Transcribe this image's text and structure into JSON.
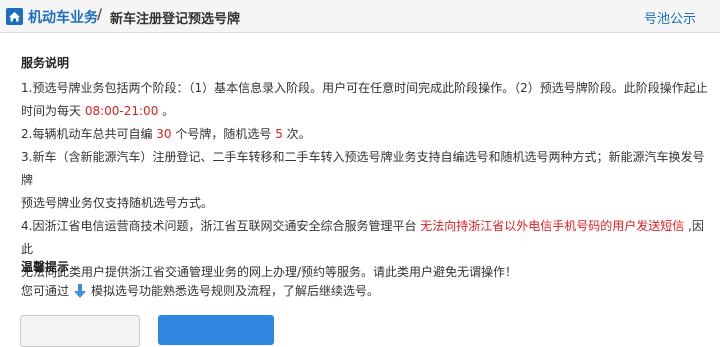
{
  "header": {
    "crumb_root": "机动车业务",
    "crumb_sep": "/",
    "crumb_current": "新车注册登记预选号牌",
    "pool_link": "号池公示"
  },
  "service": {
    "title": "服务说明",
    "p1_a": "1.预选号牌业务包括两个阶段：（1）基本信息录入阶段。用户可在任意时间完成此阶段操作。（2）预选号牌阶段。此阶段操作起止",
    "p1_b": "时间为每天 ",
    "p1_time": "08:00-21:00",
    "p1_c": " 。",
    "p2_a": "2.每辆机动车总共可自编 ",
    "p2_n1": "30",
    "p2_b": " 个号牌，随机选号 ",
    "p2_n2": "5",
    "p2_c": " 次。",
    "p3_a": "3.新车（含新能源汽车）注册登记、二手车转移和二手车转入预选号牌业务支持自编选号和随机选号两种方式；新能源汽车换发号牌",
    "p3_b": "预选号牌业务仅支持随机选号方式。",
    "p4_a": "4.因浙江省电信运营商技术问题，浙江省互联网交通安全综合服务管理平台 ",
    "p4_red": "无法向持浙江省以外电信手机号码的用户发送短信",
    "p4_b": " ,因此",
    "p4_c": "无法向此类用户提供浙江省交通管理业务的网上办理/预约等服务。请此类用户避免无谓操作！"
  },
  "tips": {
    "title": "温馨提示",
    "pre": "您可通过",
    "link": "模拟选号功能熟悉选号规则及流程",
    "post": "，了解后继续选号。"
  },
  "colors": {
    "accent": "#1b6fc2",
    "warning_red": "#e02020",
    "primary_button": "#2f86e0"
  },
  "icons": {
    "home": "home-icon",
    "download": "download-arrow-icon"
  }
}
